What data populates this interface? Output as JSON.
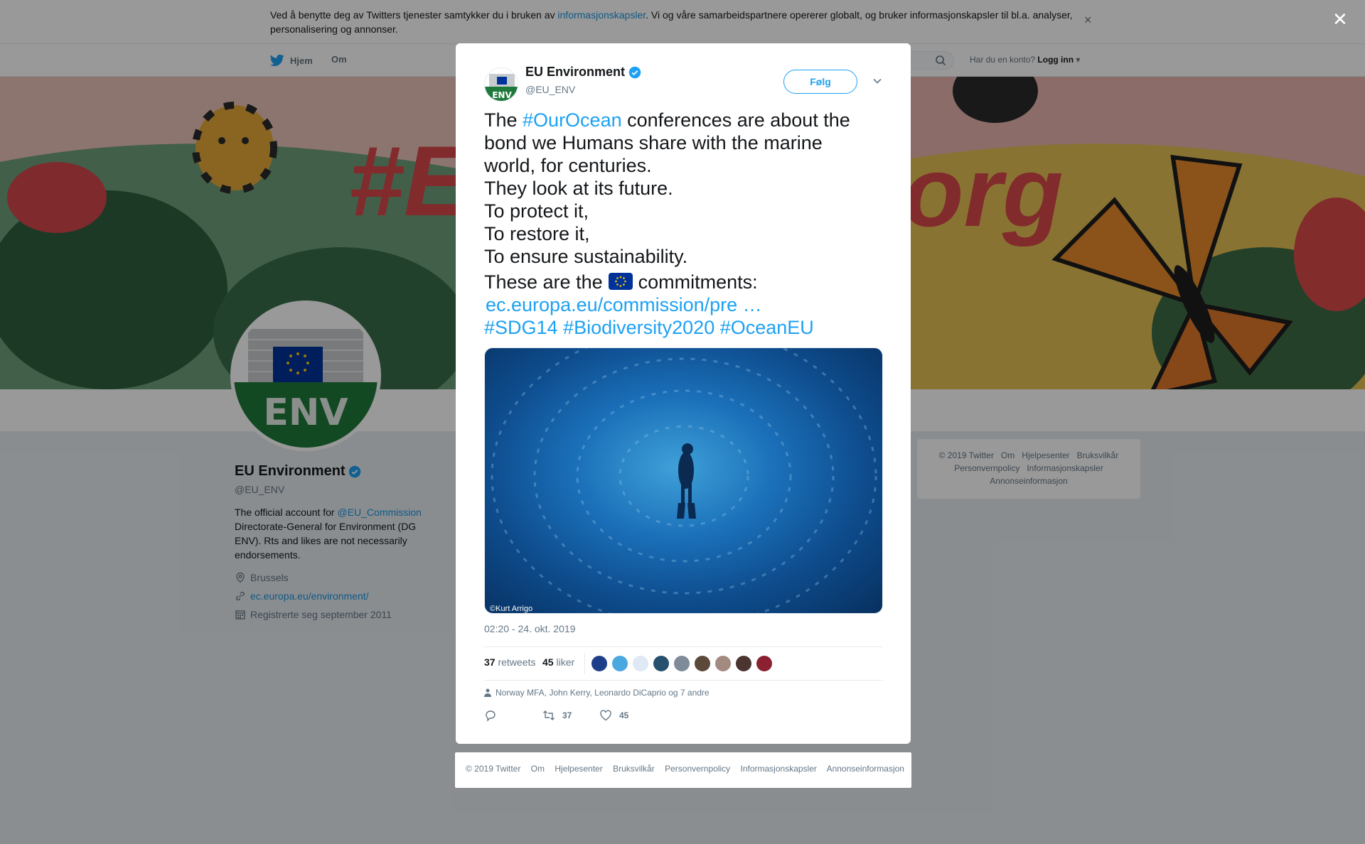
{
  "cookie": {
    "text_before": "Ved å benytte deg av Twitters tjenester samtykker du i bruken av ",
    "link": "informasjonskapsler",
    "text_after": ". Vi og våre samarbeidspartnere opererer globalt, og bruker informasjonskapsler til bl.a. analyser, personalisering og annonser.",
    "close": "×"
  },
  "nav": {
    "home": "Hjem",
    "about": "Om",
    "login_prompt": "Har du en konto?",
    "login": "Logg inn"
  },
  "profile": {
    "name": "EU Environment",
    "handle": "@EU_ENV",
    "bio_before": "The official account for ",
    "bio_mention": "@EU_Commission",
    "bio_after": " Directorate-General for Environment (DG ENV). Rts and likes are not necessarily endorsements.",
    "location": "Brussels",
    "website": "ec.europa.eu/environment/",
    "joined": "Registrerte seg september 2011",
    "avatar_label": "ENV"
  },
  "side_footer": {
    "items": [
      "© 2019 Twitter",
      "Om",
      "Hjelpesenter",
      "Bruksvilkår",
      "Personvernpolicy",
      "Informasjonskapsler",
      "Annonseinformasjon"
    ]
  },
  "overlay": {
    "close": "✕"
  },
  "tweet": {
    "author": "EU Environment",
    "handle": "@EU_ENV",
    "follow": "Følg",
    "text": {
      "l1_a": "The ",
      "l1_tag": "#OurOcean",
      "l1_b": " conferences are about the",
      "l2": "bond we Humans share with the marine",
      "l3": "world, for centuries.",
      "l4": "They look at its future.",
      "l5": "To protect it,",
      "l6": "To restore it,",
      "l7": "To ensure sustainability.",
      "l8_a": "These are the",
      "l8_b": "commitments:",
      "link": "ec.europa.eu/commission/pre …",
      "tag1": "#SDG14",
      "tag2": "#Biodiversity2020",
      "tag3": "#OceanEU"
    },
    "media_credit": "©Kurt Arrigo",
    "timestamp": "02:20 - 24. okt. 2019",
    "retweets_count": "37",
    "retweets_label": "retweets",
    "likes_count": "45",
    "likes_label": "liker",
    "likers_text": "Norway MFA, John Kerry, Leonardo DiCaprio og 7 andre",
    "actions": {
      "reply": "",
      "retweet": "37",
      "like": "45"
    },
    "accent": "#1da1f2"
  },
  "modal_footer": {
    "items": [
      "© 2019 Twitter",
      "Om",
      "Hjelpesenter",
      "Bruksvilkår",
      "Personvernpolicy",
      "Informasjonskapsler",
      "Annonseinformasjon"
    ]
  }
}
